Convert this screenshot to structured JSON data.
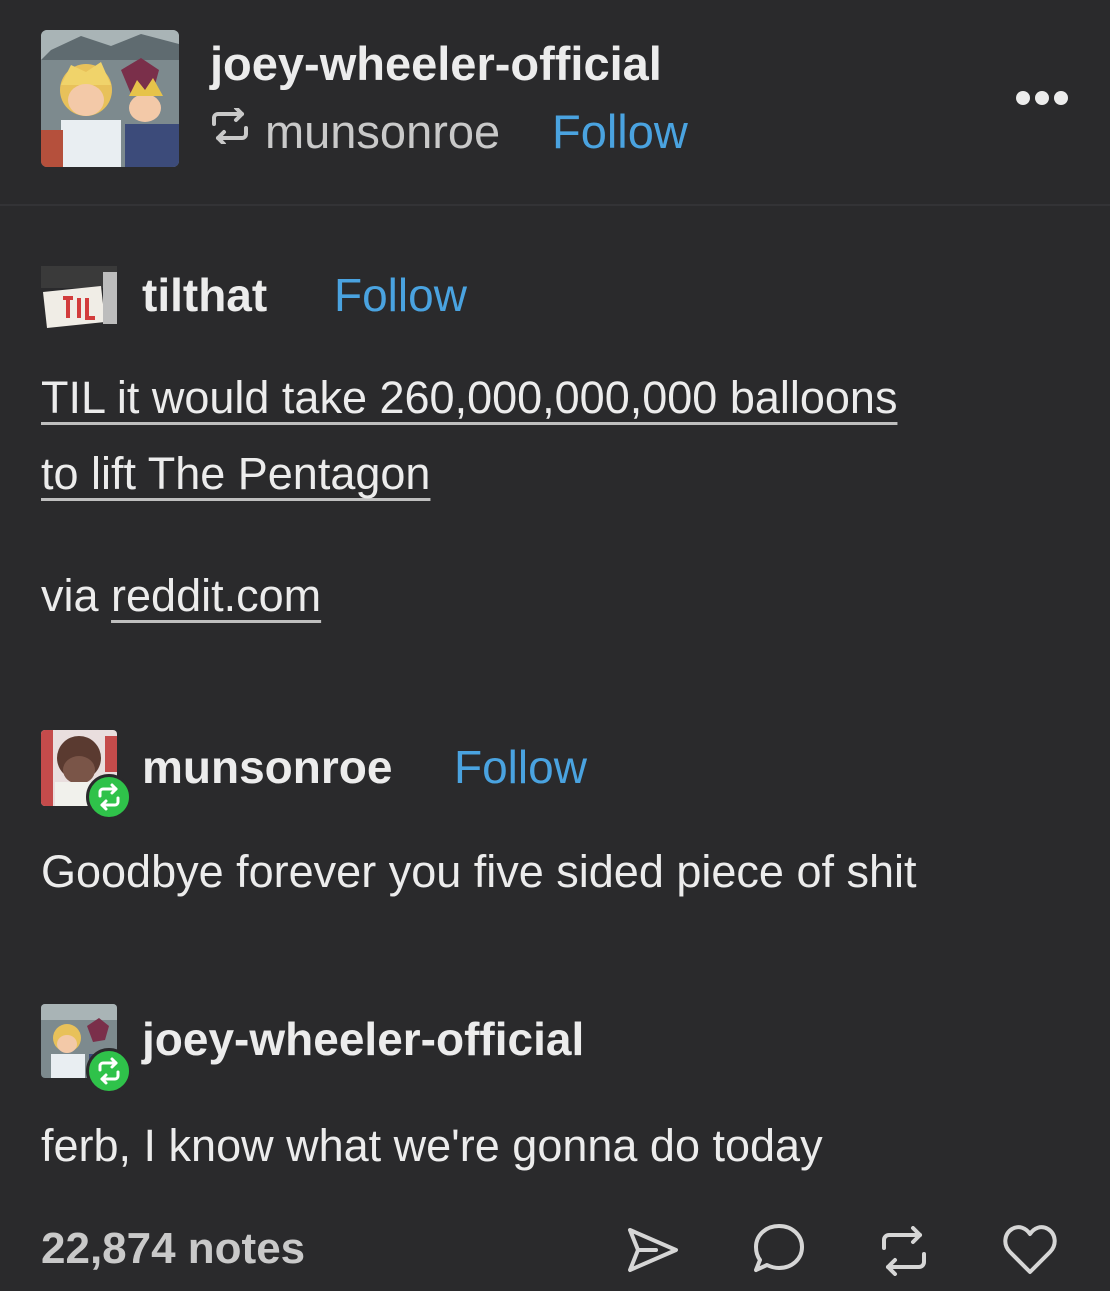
{
  "header": {
    "blog_name": "joey-wheeler-official",
    "reblogged_from": "munsonroe",
    "follow_label": "Follow",
    "more_icon": "more-horizontal-icon"
  },
  "trail": [
    {
      "username": "tilthat",
      "follow_label": "Follow",
      "link_line_1": "TIL it would take 260,000,000,000 balloons",
      "link_line_2": "to lift The Pentagon",
      "via_prefix": "via ",
      "via_link": "reddit.com"
    },
    {
      "username": "munsonroe",
      "follow_label": "Follow",
      "text": "Goodbye forever you five sided piece of shit"
    },
    {
      "username": "joey-wheeler-official",
      "text": "ferb, I know what we're gonna do today"
    }
  ],
  "footer": {
    "notes": "22,874 notes",
    "icons": [
      "share-icon",
      "comment-icon",
      "reblog-icon",
      "like-icon"
    ]
  },
  "colors": {
    "background": "#2a2a2c",
    "follow": "#4aa3e0",
    "reblog_badge": "#2fc24a",
    "text": "#ececec"
  }
}
